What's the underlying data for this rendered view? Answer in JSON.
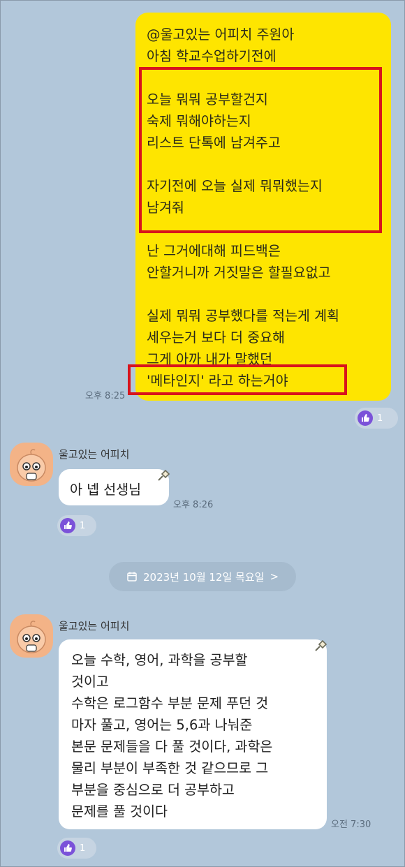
{
  "my_message": {
    "lines": [
      "@울고있는 어피치 주원아",
      "아침 학교수업하기전에",
      "",
      "오늘 뭐뭐 공부할건지",
      "숙제 뭐해야하는지",
      "리스트 단톡에 남겨주고",
      "",
      "자기전에 오늘 실제 뭐뭐했는지",
      "남겨줘",
      "",
      "난 그거에대해 피드백은",
      "안할거니까 거짓말은 할필요없고",
      "",
      "실제 뭐뭐 공부했다를 적는게 계획",
      "세우는거 보다 더 중요해",
      "그게 아까 내가 말했던",
      "'메타인지' 라고 하는거야"
    ],
    "time": "오후 8:25",
    "reaction_count": "1"
  },
  "reply": {
    "sender": "울고있는 어피치",
    "text": "아 넵 선생님",
    "time": "오후 8:26",
    "reaction_count": "1"
  },
  "date_divider": {
    "label": "2023년 10월 12일 목요일",
    "chevron": ">"
  },
  "plan_message": {
    "sender": "울고있는 어피치",
    "lines": [
      "오늘 수학, 영어, 과학을 공부할",
      "것이고",
      "수학은 로그함수 부분 문제 푸던 것",
      "마자 풀고, 영어는 5,6과 나눠준",
      "본문 문제들을 다 풀 것이다, 과학은",
      "물리 부분이 부족한 것 같으므로 그",
      "부분을 중심으로 더 공부하고",
      "문제를 풀 것이다"
    ],
    "time": "오전 7:30",
    "reaction_count": "1"
  },
  "colors": {
    "chat_background": "#b2c7da",
    "my_bubble": "#fee500",
    "highlight_box": "#d8141c",
    "reaction_thumb": "#7b52d9"
  },
  "icons": [
    "thumbs-up-icon",
    "avatar-apeach",
    "pin-icon",
    "calendar-icon",
    "chevron-right-icon"
  ]
}
